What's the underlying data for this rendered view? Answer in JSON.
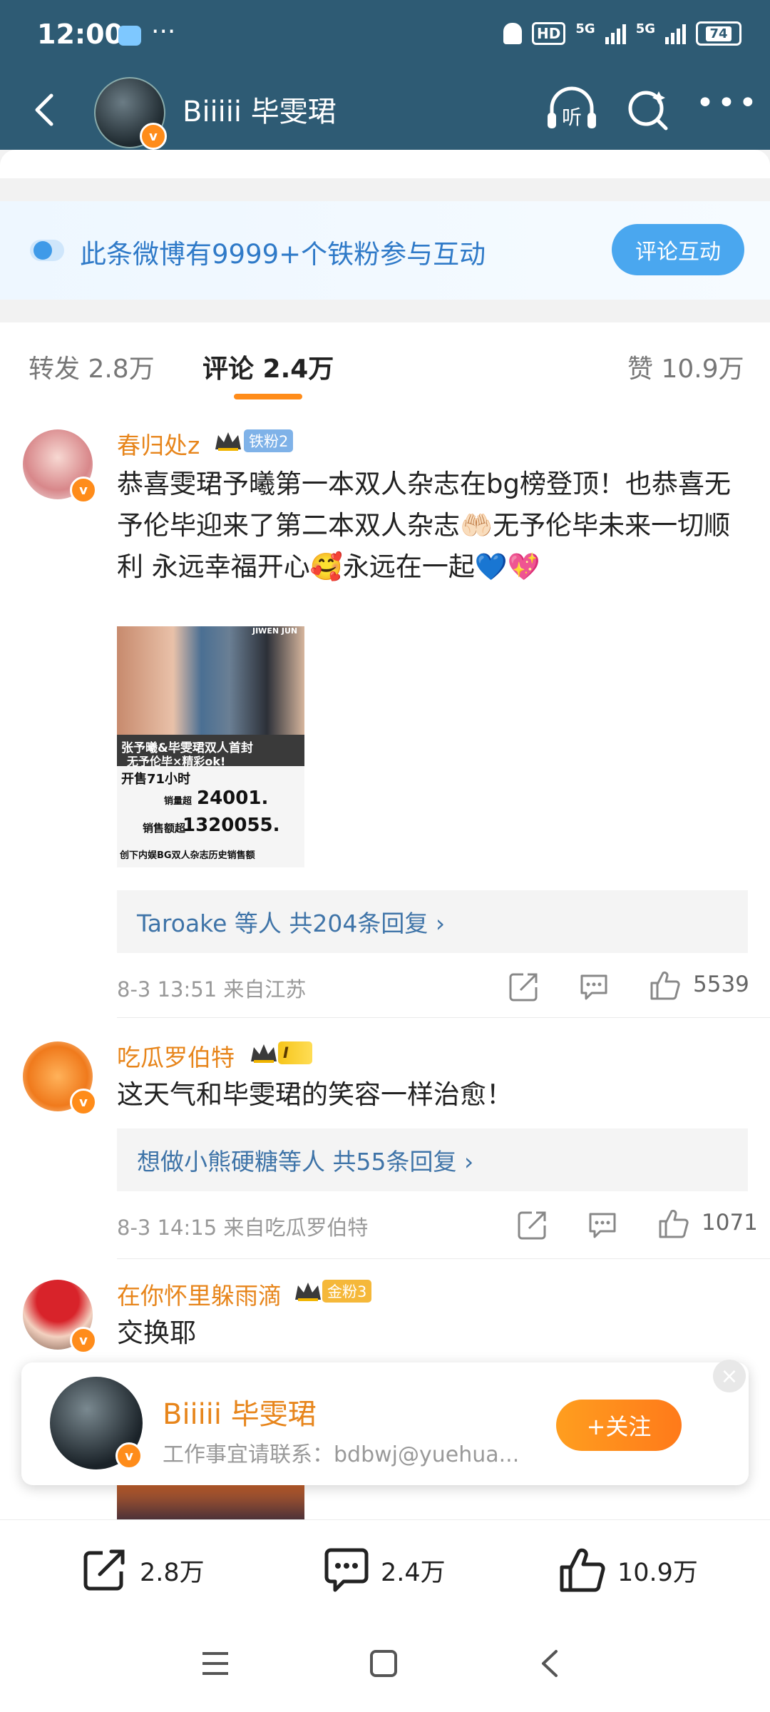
{
  "status_bar": {
    "time": "12:00",
    "dots": "···",
    "hd": "HD",
    "net1": "5G",
    "net2": "5G",
    "battery": "74"
  },
  "nav": {
    "title": "Biiiii 毕雯珺",
    "listen_label": "听"
  },
  "banner": {
    "text": "此条微博有9999+个铁粉参与互动",
    "button": "评论互动"
  },
  "tabs": {
    "repost": "转发 2.8万",
    "comment": "评论 2.4万",
    "like": "赞 10.9万"
  },
  "comments": [
    {
      "name": "春归处z",
      "badge": "铁粉2",
      "text": "恭喜雯珺予曦第一本双人杂志在bg榜登顶！也恭喜无予伦毕迎来了第二本双人杂志🤲🏻无予伦毕未来一切顺利 永远幸福开心🥰永远在一起💙💖",
      "image_text": {
        "magazine": "JIWEN JUN",
        "line1": "张予曦&毕雯珺双人首封",
        "line2": "无予伦毕×精彩ok!",
        "sale_hours": "开售71小时",
        "sales_label": "销量超",
        "sales": "24001.",
        "amount_label": "销售额超",
        "amount": "1320055.",
        "record": "创下内娱BG双人杂志历史销售额"
      },
      "replies": "Taroake 等人  共204条回复 ›",
      "meta": "8-3 13:51  来自江苏",
      "likes": "5539"
    },
    {
      "name": "吃瓜罗伯特",
      "badge": "I",
      "text": "这天气和毕雯珺的笑容一样治愈！",
      "replies": "想做小熊硬糖等人  共55条回复 ›",
      "meta": "8-3 14:15  来自吃瓜罗伯特",
      "likes": "1071"
    },
    {
      "name": "在你怀里躲雨滴",
      "badge": "金粉3",
      "text": "交换耶"
    }
  ],
  "follow_card": {
    "name": "Biiiii 毕雯珺",
    "subtitle": "工作事宜请联系：bdbwj@yuehua...",
    "button": "+关注",
    "close": "×"
  },
  "bottom_bar": {
    "repost": "2.8万",
    "comment": "2.4万",
    "like": "10.9万"
  },
  "colors": {
    "header": "#2e5b74",
    "accent_orange": "#ff8c1a",
    "link_blue": "#3f74a8",
    "banner_blue": "#4aa7ef"
  }
}
